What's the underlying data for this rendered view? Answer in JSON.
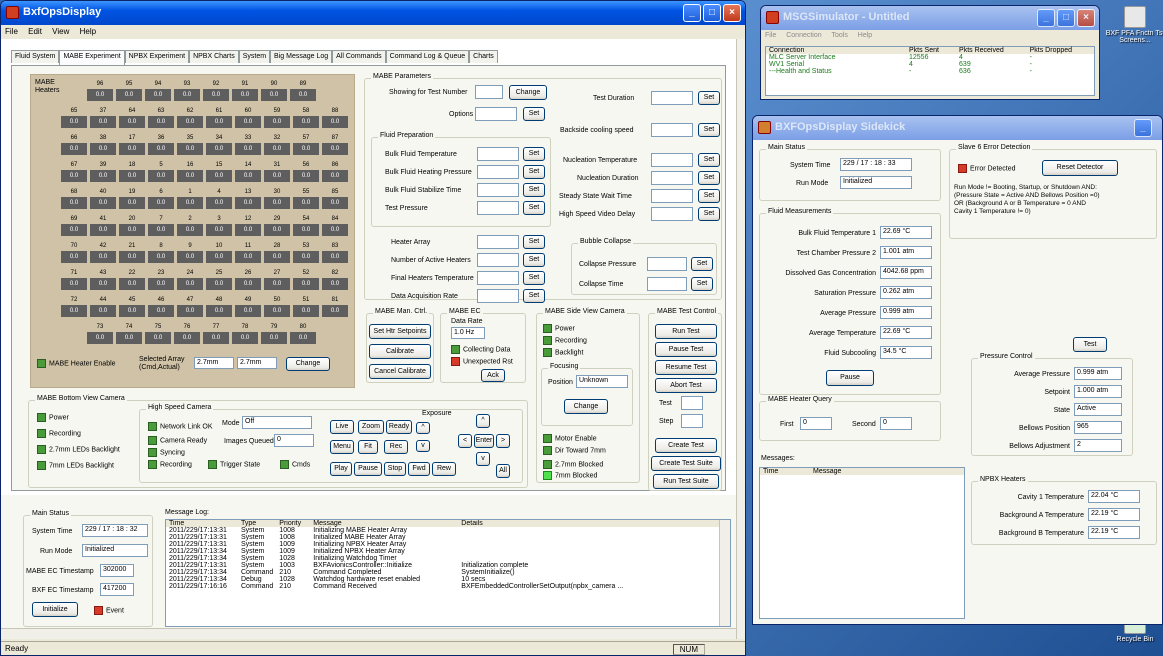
{
  "main_window": {
    "title": "BxfOpsDisplay",
    "menu": [
      "File",
      "Edit",
      "View",
      "Help"
    ],
    "tabs": [
      "Fluid System",
      "MABE Experiment",
      "NPBX Experiment",
      "NPBX Charts",
      "System",
      "Big Message Log",
      "All Commands",
      "Command Log & Queue",
      "Charts"
    ],
    "active_tab": "MABE Experiment",
    "status": "Ready",
    "num": "NUM"
  },
  "heaters": {
    "label_line1": "MABE",
    "label_line2": "Heaters",
    "value": "0.0",
    "rows": [
      [
        "96",
        "95",
        "94",
        "93",
        "92",
        "91",
        "90",
        "89"
      ],
      [
        "65",
        "37",
        "64",
        "63",
        "62",
        "61",
        "60",
        "59",
        "58",
        "88"
      ],
      [
        "66",
        "38",
        "17",
        "36",
        "35",
        "34",
        "33",
        "32",
        "57",
        "87"
      ],
      [
        "67",
        "39",
        "18",
        "5",
        "16",
        "15",
        "14",
        "31",
        "56",
        "86"
      ],
      [
        "68",
        "40",
        "19",
        "6",
        "1",
        "4",
        "13",
        "30",
        "55",
        "85"
      ],
      [
        "69",
        "41",
        "20",
        "7",
        "2",
        "3",
        "12",
        "29",
        "54",
        "84"
      ],
      [
        "70",
        "42",
        "21",
        "8",
        "9",
        "10",
        "11",
        "28",
        "53",
        "83"
      ],
      [
        "71",
        "43",
        "22",
        "23",
        "24",
        "25",
        "26",
        "27",
        "52",
        "82"
      ],
      [
        "72",
        "44",
        "45",
        "46",
        "47",
        "48",
        "49",
        "50",
        "51",
        "81"
      ],
      [
        "73",
        "74",
        "75",
        "76",
        "77",
        "78",
        "79",
        "80"
      ]
    ],
    "enable_label": "MABE Heater Enable",
    "selected_array_label": "Selected Array\n(Cmd,Actual)",
    "selected_cmd": "2.7mm",
    "selected_actual": "2.7mm",
    "change": "Change"
  },
  "params": {
    "title": "MABE Parameters",
    "showing_test": "Showing for Test Number",
    "options": "Options",
    "test_duration": "Test Duration",
    "backside_cooling": "Backside cooling speed",
    "fluid_prep": "Fluid Preparation",
    "bulk_temp": "Bulk Fluid Temperature",
    "bulk_heat_press": "Bulk Fluid Heating Pressure",
    "bulk_stab": "Bulk Fluid Stabilize Time",
    "test_pressure": "Test Pressure",
    "nucl_temp": "Nucleation Temperature",
    "nucl_dur": "Nucleation Duration",
    "steady_wait": "Steady State Wait Time",
    "hs_video_delay": "High Speed Video Delay",
    "heater_array": "Heater Array",
    "num_active": "Number of Active Heaters",
    "final_temp": "Final Heaters Temperature",
    "acq_rate": "Data Acquisition Rate",
    "bubble": "Bubble Collapse",
    "collapse_press": "Collapse Pressure",
    "collapse_time": "Collapse Time",
    "set": "Set",
    "change": "Change"
  },
  "man_ctrl": {
    "title": "MABE Man. Ctrl.",
    "set_htr": "Set Htr Setpoints",
    "calibrate": "Calibrate",
    "cancel_cal": "Cancel Calibrate"
  },
  "mabe_ec": {
    "title": "MABE EC",
    "data_rate_label": "Data Rate",
    "data_rate": "1.0 Hz",
    "collecting": "Collecting Data",
    "unexpected": "Unexpected Rst",
    "ack": "Ack"
  },
  "side_cam": {
    "title": "MABE Side View Camera",
    "power": "Power",
    "recording": "Recording",
    "backlight": "Backlight",
    "focusing": "Focusing",
    "position_label": "Position",
    "position": "Unknown",
    "change": "Change",
    "motor": "Motor Enable",
    "dir": "Dir Toward 7mm",
    "blk27": "2.7mm Blocked",
    "blk7": "7mm Blocked"
  },
  "test_ctrl": {
    "title": "MABE Test Control",
    "run": "Run Test",
    "pause": "Pause Test",
    "resume": "Resume Test",
    "abort": "Abort Test",
    "test": "Test",
    "step": "Step",
    "create": "Create Test",
    "create_suite": "Create Test Suite",
    "run_suite": "Run Test Suite"
  },
  "bottom_cam": {
    "title": "MABE Bottom View Camera",
    "power": "Power",
    "recording": "Recording",
    "leds27": "2.7mm LEDs Backlight",
    "leds7": "7mm LEDs Backlight"
  },
  "hs_cam": {
    "title": "High Speed Camera",
    "network": "Network Link OK",
    "ready": "Camera Ready",
    "syncing": "Syncing",
    "recording": "Recording",
    "trigger": "Trigger State",
    "cmds": "Cmds",
    "mode_label": "Mode",
    "mode": "Off",
    "images_label": "Images Queued",
    "images": "0",
    "exposure": "Exposure",
    "live": "Live",
    "zoom": "Zoom",
    "readyb": "Ready",
    "menu": "Menu",
    "fit": "Fit",
    "rec": "Rec",
    "play": "Play",
    "pause": "Pause",
    "stop": "Stop",
    "fwd": "Fwd",
    "rew": "Rew",
    "enter": "Enter",
    "all": "All",
    "up": "^",
    "down": "v",
    "left": "<",
    "right": ">"
  },
  "main_status": {
    "title": "Main Status",
    "sys_time_label": "System Time",
    "sys_time": "229 / 17 : 18 : 32",
    "run_mode_label": "Run Mode",
    "run_mode": "Initialized",
    "mabe_ts_label": "MABE EC Timestamp",
    "mabe_ts": "302000",
    "bxf_ts_label": "BXF EC Timestamp",
    "bxf_ts": "417200",
    "initialize": "Initialize",
    "event": "Event"
  },
  "msglog": {
    "title": "Message Log:",
    "headers": [
      "Time",
      "Type",
      "Priority",
      "Message",
      "Details"
    ],
    "rows": [
      [
        "2011/229/17:13:31",
        "System",
        "1008",
        "Initializing MABE Heater Array",
        ""
      ],
      [
        "2011/229/17:13:31",
        "System",
        "1008",
        "Initialized MABE Heater Array",
        ""
      ],
      [
        "2011/229/17:13:31",
        "System",
        "1009",
        "Initializing NPBX Heater Array",
        ""
      ],
      [
        "2011/229/17:13:34",
        "System",
        "1009",
        "Initialized NPBX Heater Array",
        ""
      ],
      [
        "2011/229/17:13:34",
        "System",
        "1028",
        "Initializing Watchdog Timer",
        ""
      ],
      [
        "2011/229/17:13:31",
        "System",
        "1003",
        "BXFAvionicsController::Initialize",
        "Initialization complete"
      ],
      [
        "2011/229/17:13:34",
        "Command",
        "210",
        "Command Completed",
        "SystemInitialize()"
      ],
      [
        "2011/229/17:13:34",
        "Debug",
        "1028",
        "Watchdog hardware reset enabled",
        "10 secs"
      ],
      [
        "2011/229/17:16:16",
        "Command",
        "210",
        "Command Received",
        "BXFEmbeddedControllerSetOutput(npbx_camera ..."
      ]
    ]
  },
  "msgsim": {
    "title": "MSGSimulator - Untitled",
    "menu": [
      "File",
      "Connection",
      "Tools",
      "Help"
    ],
    "headers": [
      "Connection",
      "Pkts Sent",
      "Pkts Received",
      "Pkts Dropped"
    ],
    "rows": [
      [
        "MLC Server Interface",
        "12556",
        "4",
        "-"
      ],
      [
        "WV1 Serial",
        "4",
        "639",
        "-"
      ],
      [
        "---Health and Status",
        "-",
        "636",
        "-"
      ]
    ]
  },
  "sidekick": {
    "title": "BXFOpsDisplay Sidekick",
    "main_status": "Main Status",
    "sys_time_label": "System Time",
    "sys_time": "229 / 17 : 18 : 33",
    "run_mode_label": "Run Mode",
    "run_mode": "Initialized",
    "fluid": "Fluid Measurements",
    "fluid_rows": [
      [
        "Bulk Fluid Temperature 1",
        "22.69 °C"
      ],
      [
        "Test Chamber Pressure 2",
        "1.001 atm"
      ],
      [
        "Dissolved Gas Concentration",
        "4042.68 ppm"
      ],
      [
        "Saturation Pressure",
        "0.262 atm"
      ],
      [
        "Average Pressure",
        "0.999 atm"
      ],
      [
        "Average Temperature",
        "22.69 °C"
      ],
      [
        "Fluid Subcooling",
        "34.5 °C"
      ]
    ],
    "pause": "Pause",
    "query": "MABE Heater Query",
    "first_label": "First",
    "first": "0",
    "second_label": "Second",
    "second": "0",
    "messages": "Messages:",
    "msg_headers": [
      "Time",
      "Message"
    ],
    "slave": "Slave 6 Error Detection",
    "error_detected": "Error Detected",
    "reset": "Reset Detector",
    "rule": "Run Mode != Booting, Startup, or Shutdown AND:\n(Pressure State = Active AND Bellows Position =0)\nOR (Background A or B Temperature = 0 AND\nCavity 1 Temperature != 0)",
    "test": "Test",
    "pressure": "Pressure Control",
    "pressure_rows": [
      [
        "Average Pressure",
        "0.999 atm"
      ],
      [
        "Setpoint",
        "1.000 atm"
      ],
      [
        "State",
        "Active"
      ],
      [
        "Bellows Position",
        "965"
      ],
      [
        "Bellows Adjustment",
        "2"
      ]
    ],
    "npbx": "NPBX Heaters",
    "npbx_rows": [
      [
        "Cavity 1 Temperature",
        "22.04 °C"
      ],
      [
        "Background A Temperature",
        "22.19 °C"
      ],
      [
        "Background B Temperature",
        "22.19 °C"
      ]
    ]
  },
  "desktop": {
    "icon1": "BXF PFA Fnctn Tst Screens...",
    "recycle": "Recycle Bin"
  }
}
